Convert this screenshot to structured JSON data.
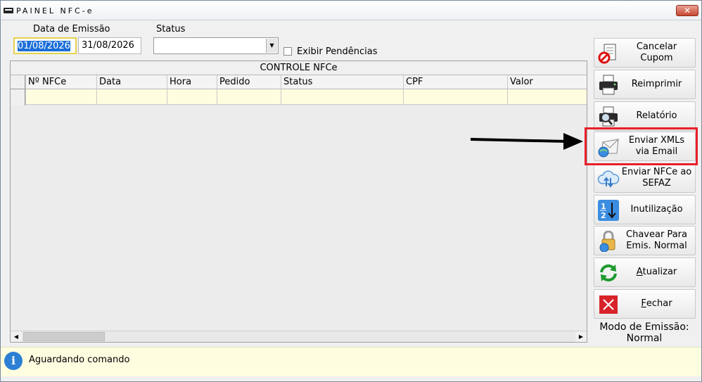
{
  "window": {
    "title": "PAINEL NFC-e",
    "close_label": "✕"
  },
  "filters": {
    "emission_label": "Data de Emissão",
    "date_from": "01/08/2026",
    "date_to": "31/08/2026",
    "status_label": "Status",
    "status_value": "",
    "pending_label": "Exibir Pendências",
    "pending_checked": false
  },
  "grid": {
    "caption": "CONTROLE NFCe",
    "columns": [
      "Nº NFCe",
      "Data",
      "Hora",
      "Pedido",
      "Status",
      "CPF",
      "Valor"
    ],
    "rows": []
  },
  "actions": [
    {
      "name": "cancelar-cupom-button",
      "icon": "cancel-document-icon",
      "label": "Cancelar Cupom"
    },
    {
      "name": "reimprimir-button",
      "icon": "printer-icon",
      "label": "Reimprimir"
    },
    {
      "name": "relatorio-button",
      "icon": "report-printer-icon",
      "label": "Relatório"
    },
    {
      "name": "enviar-xmls-email-button",
      "icon": "email-globe-icon",
      "label": "Enviar XMLs via Email"
    },
    {
      "name": "enviar-nfce-sefaz-button",
      "icon": "cloud-upload-icon",
      "label": "Enviar NFCe ao SEFAZ"
    },
    {
      "name": "inutilizacao-button",
      "icon": "numbering-icon",
      "label": "Inutilização"
    },
    {
      "name": "chavear-emissao-button",
      "icon": "lock-globe-icon",
      "label": "Chavear Para Emis. Normal"
    },
    {
      "name": "atualizar-button",
      "icon": "refresh-icon",
      "label": "Atualizar"
    },
    {
      "name": "fechar-button",
      "icon": "close-x-icon",
      "label": "Fechar"
    }
  ],
  "emission_mode": {
    "label": "Modo de Emissão:",
    "value": "Normal"
  },
  "status": {
    "message": "Aguardando comando"
  },
  "colors": {
    "highlight": "#e8202a",
    "row_bg": "#fffde0",
    "selection": "#1a6ed8"
  }
}
